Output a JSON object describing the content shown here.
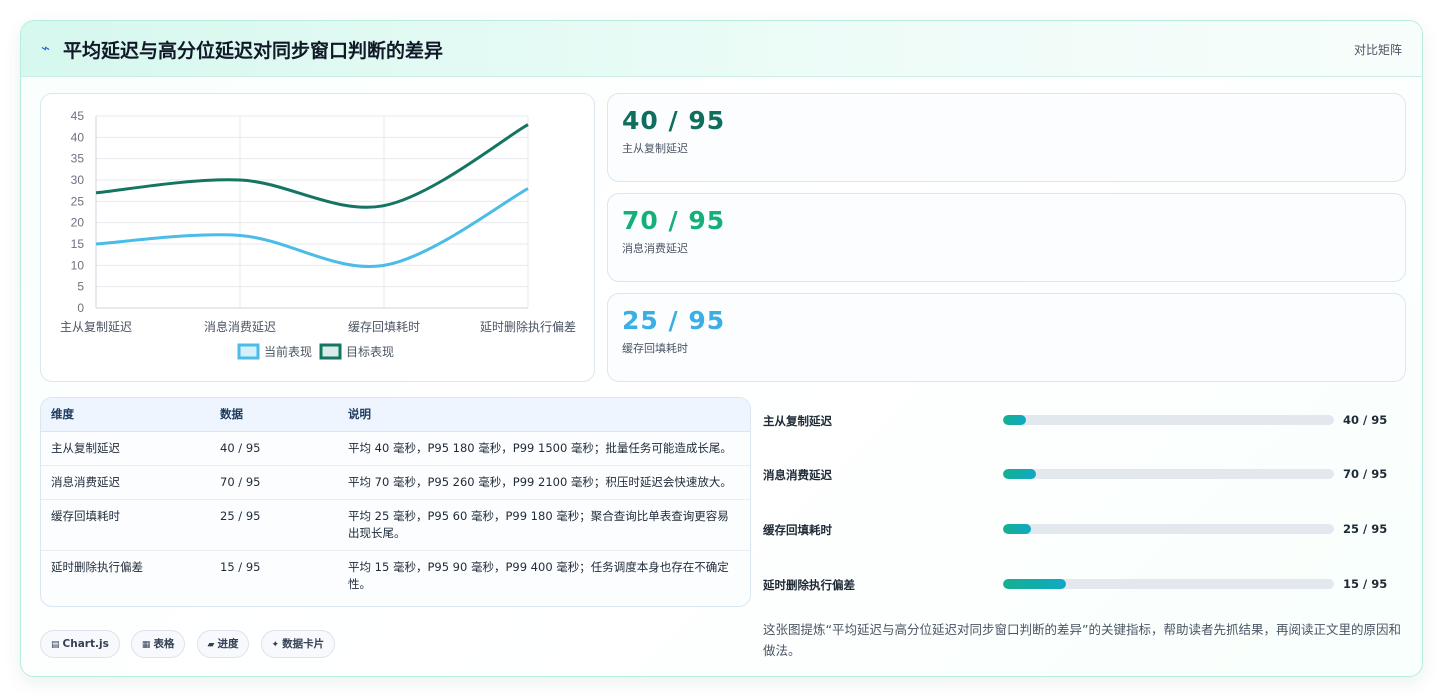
{
  "header": {
    "title": "平均延迟与高分位延迟对同步窗口判断的差异",
    "tag": "对比矩阵"
  },
  "chart_data": {
    "type": "line",
    "categories": [
      "主从复制延迟",
      "消息消费延迟",
      "缓存回填耗时",
      "延时删除执行偏差"
    ],
    "series": [
      {
        "name": "当前表现",
        "values": [
          15,
          17,
          10,
          28
        ],
        "color": "#4bbbe8"
      },
      {
        "name": "目标表现",
        "values": [
          27,
          30,
          24,
          43
        ],
        "color": "#147563"
      }
    ],
    "ylim": [
      0,
      45
    ],
    "yticks": [
      0,
      5,
      10,
      15,
      20,
      25,
      30,
      35,
      40,
      45
    ],
    "grid": true,
    "legend": "bottom"
  },
  "stats": [
    {
      "value": "40 / 95",
      "label": "主从复制延迟",
      "color": "#0f6e5e"
    },
    {
      "value": "70 / 95",
      "label": "消息消费延迟",
      "color": "#13b07a"
    },
    {
      "value": "25 / 95",
      "label": "缓存回填耗时",
      "color": "#3aaee5"
    }
  ],
  "table": {
    "headers": [
      "维度",
      "数据",
      "说明"
    ],
    "rows": [
      {
        "dim": "主从复制延迟",
        "data": "40 / 95",
        "desc": "平均 40 毫秒，P95 180 毫秒，P99 1500 毫秒；批量任务可能造成长尾。"
      },
      {
        "dim": "消息消费延迟",
        "data": "70 / 95",
        "desc": "平均 70 毫秒，P95 260 毫秒，P99 2100 毫秒；积压时延迟会快速放大。"
      },
      {
        "dim": "缓存回填耗时",
        "data": "25 / 95",
        "desc": "平均 25 毫秒，P95 60 毫秒，P99 180 毫秒；聚合查询比单表查询更容易出现长尾。"
      },
      {
        "dim": "延时删除执行偏差",
        "data": "15 / 95",
        "desc": "平均 15 毫秒，P95 90 毫秒，P99 400 毫秒；任务调度本身也存在不确定性。"
      }
    ]
  },
  "progress": [
    {
      "label": "主从复制延迟",
      "value": "40 / 95",
      "fraction": 0.07
    },
    {
      "label": "消息消费延迟",
      "value": "70 / 95",
      "fraction": 0.1
    },
    {
      "label": "缓存回填耗时",
      "value": "25 / 95",
      "fraction": 0.085
    },
    {
      "label": "延时删除执行偏差",
      "value": "15 / 95",
      "fraction": 0.19
    }
  ],
  "note": "这张图提炼“平均延迟与高分位延迟对同步窗口判断的差异”的关键指标，帮助读者先抓结果，再阅读正文里的原因和做法。",
  "chips": [
    {
      "icon": "chart-icon",
      "glyph": "▤",
      "label": "Chart.js"
    },
    {
      "icon": "table-icon",
      "glyph": "▦",
      "label": "表格"
    },
    {
      "icon": "progress-icon",
      "glyph": "▰",
      "label": "进度"
    },
    {
      "icon": "card-icon",
      "glyph": "✦",
      "label": "数据卡片"
    }
  ]
}
